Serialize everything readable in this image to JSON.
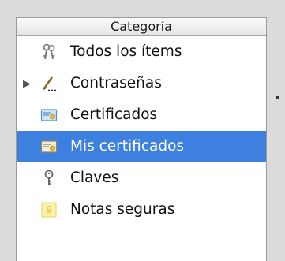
{
  "header": {
    "title": "Categoría"
  },
  "items": [
    {
      "label": "Todos los ítems",
      "icon": "keys-icon"
    },
    {
      "label": "Contraseñas",
      "icon": "pen-icon",
      "expandable": true
    },
    {
      "label": "Certificados",
      "icon": "certificate-icon"
    },
    {
      "label": "Mis certificados",
      "icon": "certificate-icon",
      "selected": true
    },
    {
      "label": "Claves",
      "icon": "key-icon"
    },
    {
      "label": "Notas seguras",
      "icon": "secure-note-icon"
    }
  ],
  "colors": {
    "selection": "#3d80df",
    "panel": "#ffffff",
    "background": "#dcdcdc"
  }
}
